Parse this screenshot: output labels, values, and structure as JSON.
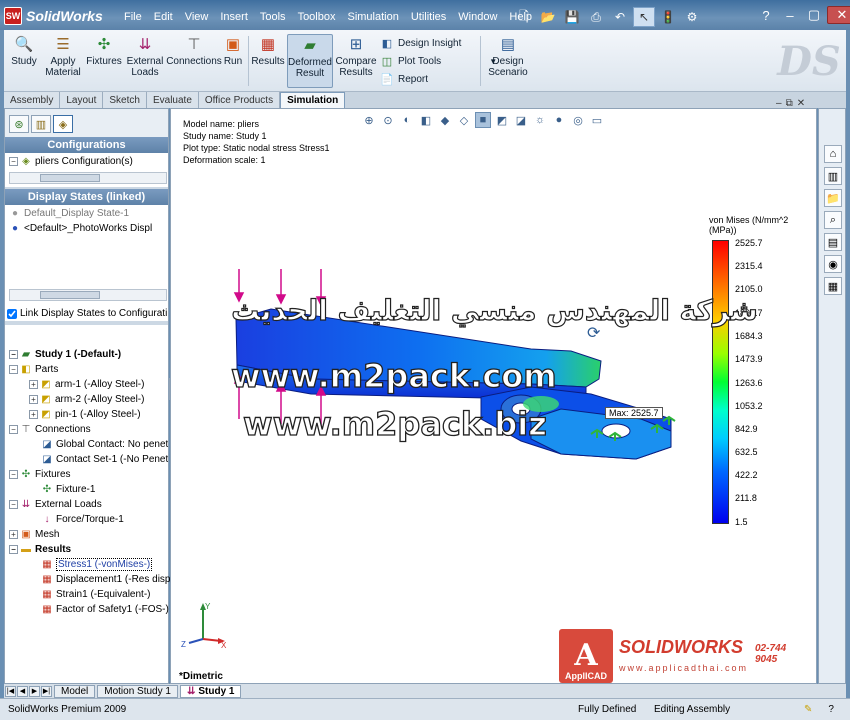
{
  "app": {
    "name": "SolidWorks",
    "logo_badge": "SW",
    "menu": [
      "File",
      "Edit",
      "View",
      "Insert",
      "Tools",
      "Toolbox",
      "Simulation",
      "Utilities",
      "Window",
      "Help"
    ]
  },
  "command_manager": {
    "study": "Study",
    "apply_material_1": "Apply",
    "apply_material_2": "Material",
    "fixtures": "Fixtures",
    "external_loads_1": "External",
    "external_loads_2": "Loads",
    "connections": "Connections",
    "run": "Run",
    "results": "Results",
    "deformed_result_1": "Deformed",
    "deformed_result_2": "Result",
    "compare_results_1": "Compare",
    "compare_results_2": "Results",
    "design_insight": "Design Insight",
    "plot_tools": "Plot Tools",
    "report": "Report",
    "design_scenario_1": "Design",
    "design_scenario_2": "Scenario"
  },
  "tabs": [
    "Assembly",
    "Layout",
    "Sketch",
    "Evaluate",
    "Office Products",
    "Simulation"
  ],
  "active_tab": "Simulation",
  "left_panel": {
    "configurations_header": "Configurations",
    "pliers_configuration": "pliers Configuration(s)",
    "display_states_header": "Display States (linked)",
    "default_display_state": "Default_Display State-1",
    "photoworks_display": "<Default>_PhotoWorks Displ",
    "link_display_states": "Link Display States to Configurati"
  },
  "tree": {
    "study": "Study 1 (-Default-)",
    "parts": "Parts",
    "arm1": "arm-1 (-Alloy Steel-)",
    "arm2": "arm-2 (-Alloy Steel-)",
    "pin1": "pin-1 (-Alloy Steel-)",
    "connections": "Connections",
    "global_contact": "Global Contact: No penet",
    "contact_set": "Contact Set-1 (-No Penet",
    "fixtures": "Fixtures",
    "fixture1": "Fixture-1",
    "external_loads": "External Loads",
    "force_torque": "Force/Torque-1",
    "mesh": "Mesh",
    "results": "Results",
    "stress1": "Stress1 (-vonMises-)",
    "displacement1": "Displacement1 (-Res disp-",
    "strain1": "Strain1 (-Equivalent-)",
    "fos1": "Factor of Safety1 (-FOS-)"
  },
  "viewport": {
    "model_name": "Model name: pliers",
    "study_name": "Study name: Study 1",
    "plot_type": "Plot type: Static nodal stress Stress1",
    "deformation_scale": "Deformation scale: 1",
    "legend_title": "von Mises (N/mm^2 (MPa))",
    "legend_ticks": [
      "2525.7",
      "2315.4",
      "2105.0",
      "1894.7",
      "1684.3",
      "1473.9",
      "1263.6",
      "1053.2",
      "842.9",
      "632.5",
      "422.2",
      "211.8",
      "1.5"
    ],
    "max_label": "Max: 2525.7",
    "view_orientation": "*Dimetric",
    "watermark_arabic": "شركة المهندس منسي التغليف الحديث",
    "watermark_url1": "www.m2pack.com",
    "watermark_url2": "www.m2pack.biz",
    "applicad": "ApplICAD",
    "sw_brand": "SOLIDWORKS",
    "sw_phone": "02-744 9045",
    "sw_url": "www.applicadthai.com"
  },
  "bottom_tabs": [
    "Model",
    "Motion Study 1",
    "Study 1"
  ],
  "status": {
    "product": "SolidWorks Premium 2009",
    "defined": "Fully Defined",
    "mode": "Editing Assembly"
  },
  "colors": {
    "title_bar": "#3f6f9f",
    "header_blue": "#5e82a8",
    "accent_red": "#d23c2e"
  }
}
